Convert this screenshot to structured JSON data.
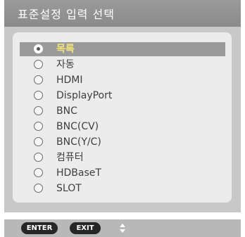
{
  "dialog": {
    "title": "표준설정 입력 선택"
  },
  "options": [
    {
      "label": "목록",
      "selected": true
    },
    {
      "label": "자동",
      "selected": false
    },
    {
      "label": "HDMI",
      "selected": false
    },
    {
      "label": "DisplayPort",
      "selected": false
    },
    {
      "label": "BNC",
      "selected": false
    },
    {
      "label": "BNC(CV)",
      "selected": false
    },
    {
      "label": "BNC(Y/C)",
      "selected": false
    },
    {
      "label": "컴퓨터",
      "selected": false
    },
    {
      "label": "HDBaseT",
      "selected": false
    },
    {
      "label": "SLOT",
      "selected": false
    }
  ],
  "footer": {
    "enter_label": "ENTER",
    "exit_label": "EXIT",
    "updown_icon": "up-down-arrows-icon"
  },
  "colors": {
    "selected_text": "#f3e37a",
    "selected_row": "#9a9a9a",
    "panel": "#c8c8c8",
    "inner": "#ececec"
  }
}
